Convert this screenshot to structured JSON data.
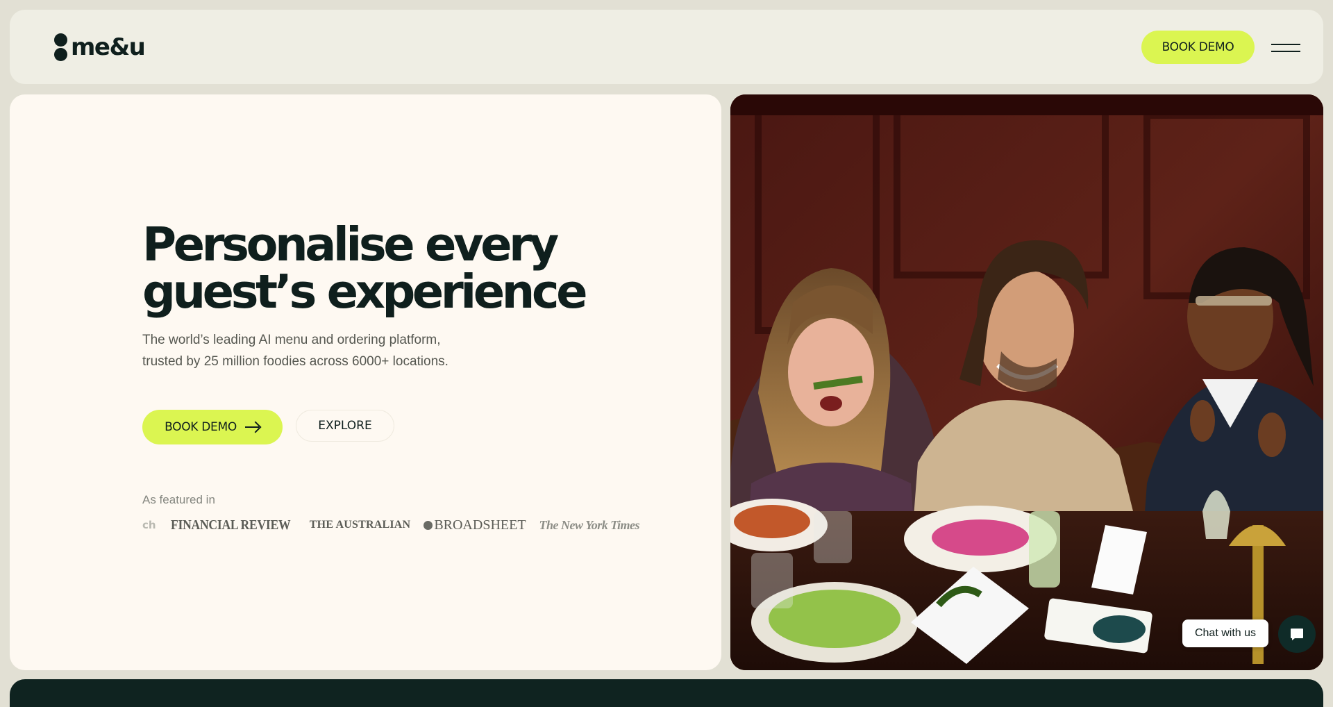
{
  "brand": {
    "name": "me&u"
  },
  "header": {
    "cta_label": "BOOK DEMO",
    "menu_icon": "hamburger-icon"
  },
  "hero": {
    "headline_line1": "Personalise every",
    "headline_line2": "guest’s experience",
    "sub_line1": "The world’s leading AI menu and ordering platform,",
    "sub_line2": "trusted by 25 million foodies across 6000+ locations.",
    "primary_cta": "BOOK DEMO",
    "secondary_cta": "EXPLORE",
    "featured_label": "As featured in",
    "press": [
      "ch",
      "FINANCIAL REVIEW",
      "THE AUSTRALIAN",
      "BROADSHEET",
      "The New York Times"
    ]
  },
  "chat": {
    "label": "Chat with us",
    "icon": "chat-bubble-icon"
  },
  "colors": {
    "accent": "#dbf551",
    "dark": "#0f1f1d",
    "page_bg": "#e2e0d4",
    "card_bg": "#fef9f2"
  }
}
